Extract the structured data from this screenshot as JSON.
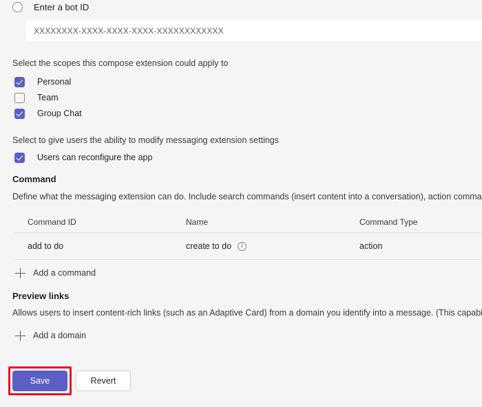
{
  "bot": {
    "radio_label": "Enter a bot ID",
    "radio_selected": false,
    "input_value": "XXXXXXXX-XXXX-XXXX-XXXX-XXXXXXXXXXXX"
  },
  "scopes": {
    "prompt": "Select the scopes this compose extension could apply to",
    "items": [
      {
        "label": "Personal",
        "checked": true
      },
      {
        "label": "Team",
        "checked": false
      },
      {
        "label": "Group Chat",
        "checked": true
      }
    ]
  },
  "settings": {
    "prompt": "Select to give users the ability to modify messaging extension settings",
    "items": [
      {
        "label": "Users can reconfigure the app",
        "checked": true
      }
    ]
  },
  "command_section": {
    "heading": "Command",
    "description": "Define what the messaging extension can do. Include search commands (insert content into a conversation), action commands (a",
    "columns": [
      "Command ID",
      "Name",
      "Command Type"
    ],
    "rows": [
      {
        "command_id": "add to do",
        "name": "create to do",
        "name_info_icon": "info-icon",
        "command_type": "action"
      }
    ],
    "add_label": "Add a command",
    "add_icon": "plus-icon"
  },
  "preview_links": {
    "heading": "Preview links",
    "description": "Allows users to insert content-rich links (such as an Adaptive Card) from a domain you identify into a message. (This capability is",
    "add_label": "Add a domain",
    "add_icon": "plus-icon"
  },
  "footer": {
    "save_label": "Save",
    "revert_label": "Revert"
  },
  "colors": {
    "accent": "#5b5fc7",
    "background": "#f5f5f5",
    "highlight": "#e81123",
    "divider": "#e1dfdd"
  }
}
